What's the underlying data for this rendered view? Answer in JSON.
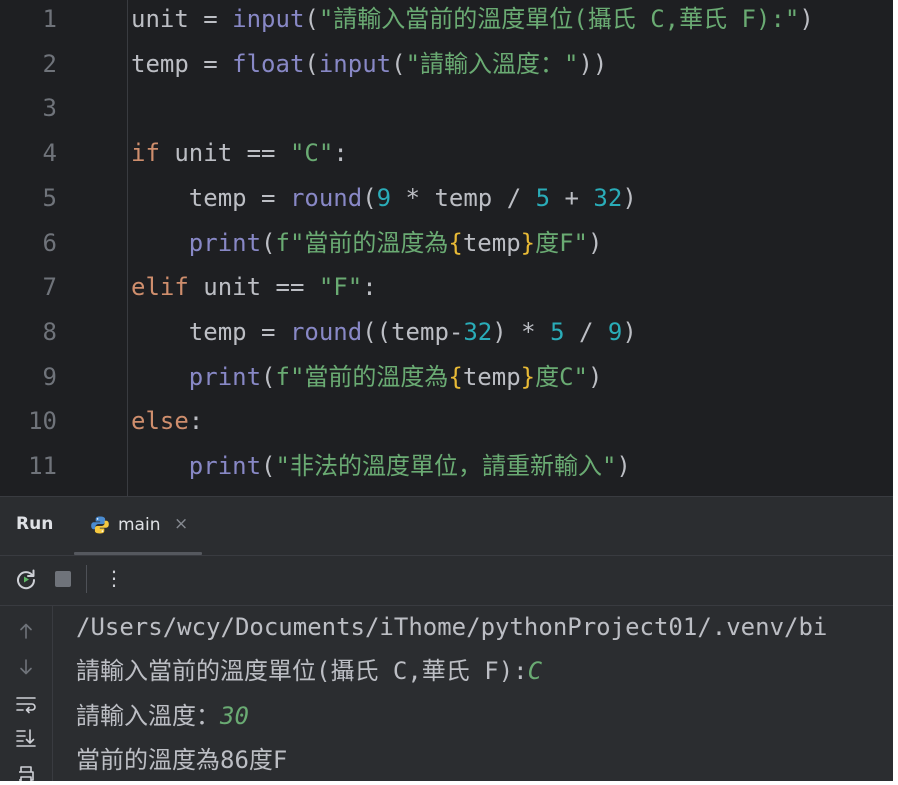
{
  "editor": {
    "line_numbers": [
      "1",
      "2",
      "3",
      "4",
      "5",
      "6",
      "7",
      "8",
      "9",
      "10",
      "11"
    ],
    "lines": [
      [
        {
          "t": "unit = ",
          "c": ""
        },
        {
          "t": "input",
          "c": "fn"
        },
        {
          "t": "(",
          "c": ""
        },
        {
          "t": "\"請輸入當前的溫度單位(攝氏 C,華氏 F):\"",
          "c": "str"
        },
        {
          "t": ")",
          "c": ""
        }
      ],
      [
        {
          "t": "temp = ",
          "c": ""
        },
        {
          "t": "float",
          "c": "fn"
        },
        {
          "t": "(",
          "c": ""
        },
        {
          "t": "input",
          "c": "fn"
        },
        {
          "t": "(",
          "c": ""
        },
        {
          "t": "\"請輸入溫度：\"",
          "c": "str"
        },
        {
          "t": "))",
          "c": ""
        }
      ],
      [],
      [
        {
          "t": "if",
          "c": "kw"
        },
        {
          "t": " unit == ",
          "c": ""
        },
        {
          "t": "\"C\"",
          "c": "str"
        },
        {
          "t": ":",
          "c": ""
        }
      ],
      [
        {
          "t": "    temp = ",
          "c": ""
        },
        {
          "t": "round",
          "c": "fn"
        },
        {
          "t": "(",
          "c": ""
        },
        {
          "t": "9",
          "c": "num"
        },
        {
          "t": " * temp / ",
          "c": ""
        },
        {
          "t": "5",
          "c": "num"
        },
        {
          "t": " + ",
          "c": ""
        },
        {
          "t": "32",
          "c": "num"
        },
        {
          "t": ")",
          "c": ""
        }
      ],
      [
        {
          "t": "    ",
          "c": ""
        },
        {
          "t": "print",
          "c": "fn"
        },
        {
          "t": "(",
          "c": ""
        },
        {
          "t": "f\"當前的溫度為",
          "c": "str"
        },
        {
          "t": "{",
          "c": "br"
        },
        {
          "t": "temp",
          "c": ""
        },
        {
          "t": "}",
          "c": "br"
        },
        {
          "t": "度F\"",
          "c": "str"
        },
        {
          "t": ")",
          "c": ""
        }
      ],
      [
        {
          "t": "elif",
          "c": "kw"
        },
        {
          "t": " unit == ",
          "c": ""
        },
        {
          "t": "\"F\"",
          "c": "str"
        },
        {
          "t": ":",
          "c": ""
        }
      ],
      [
        {
          "t": "    temp = ",
          "c": ""
        },
        {
          "t": "round",
          "c": "fn"
        },
        {
          "t": "((temp-",
          "c": ""
        },
        {
          "t": "32",
          "c": "num"
        },
        {
          "t": ") * ",
          "c": ""
        },
        {
          "t": "5",
          "c": "num"
        },
        {
          "t": " / ",
          "c": ""
        },
        {
          "t": "9",
          "c": "num"
        },
        {
          "t": ")",
          "c": ""
        }
      ],
      [
        {
          "t": "    ",
          "c": ""
        },
        {
          "t": "print",
          "c": "fn"
        },
        {
          "t": "(",
          "c": ""
        },
        {
          "t": "f\"當前的溫度為",
          "c": "str"
        },
        {
          "t": "{",
          "c": "br"
        },
        {
          "t": "temp",
          "c": ""
        },
        {
          "t": "}",
          "c": "br"
        },
        {
          "t": "度C\"",
          "c": "str"
        },
        {
          "t": ")",
          "c": ""
        }
      ],
      [
        {
          "t": "else",
          "c": "kw"
        },
        {
          "t": ":",
          "c": ""
        }
      ],
      [
        {
          "t": "    ",
          "c": ""
        },
        {
          "t": "print",
          "c": "fn"
        },
        {
          "t": "(",
          "c": ""
        },
        {
          "t": "\"非法的溫度單位，請重新輸入\"",
          "c": "str"
        },
        {
          "t": ")",
          "c": ""
        }
      ]
    ]
  },
  "run_panel": {
    "title": "Run",
    "tab": {
      "label": "main",
      "close": "×",
      "icon": "python-icon"
    },
    "toolbar": {
      "more": "⋮"
    }
  },
  "console": {
    "path_line": "/Users/wcy/Documents/iThome/pythonProject01/.venv/bi",
    "prompt1": "請輸入當前的溫度單位(攝氏 C,華氏 F):",
    "input1": "C",
    "prompt2": "請輸入溫度：",
    "input2": "30",
    "result": "當前的溫度為86度F"
  },
  "colors": {
    "background": "#1e1f22",
    "keyword": "#cf8e6d",
    "function": "#8888c6",
    "string": "#6aab73",
    "number": "#2aacb8",
    "brace": "#e8ba36"
  }
}
